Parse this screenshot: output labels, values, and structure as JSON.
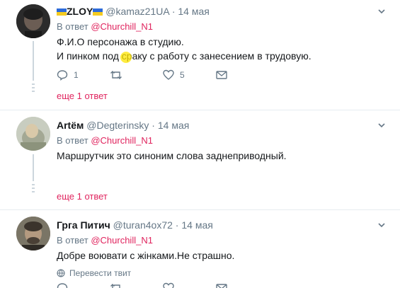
{
  "colors": {
    "accent": "#e0245e",
    "muted": "#657786",
    "text": "#14171a",
    "divider": "#e6ecf0",
    "thread": "#ccd6dd"
  },
  "tweets": [
    {
      "name": "ZLOY",
      "name_flags": [
        "ukraine-flag-icon",
        "ukraine-flag-icon"
      ],
      "handle": "@kamaz21UA",
      "dot": "·",
      "time": "14 мая",
      "reply_prefix": "В ответ",
      "reply_to": "@Churchill_N1",
      "lines": [
        "Ф.И.О персонажа в студию.",
        "И пинком под сраку с работу с занесением в трудовую."
      ],
      "reply_count": "1",
      "retweet_count": "",
      "like_count": "5",
      "more_replies": "еще 1 ответ"
    },
    {
      "name": "Artём",
      "handle": "@Degterinsky",
      "dot": "·",
      "time": "14 мая",
      "reply_prefix": "В ответ",
      "reply_to": "@Churchill_N1",
      "lines": [
        "Маршрутчик это синоним слова заднеприводный."
      ],
      "more_replies": "еще 1 ответ"
    },
    {
      "name": "Грга Питич",
      "handle": "@turan4ox72",
      "dot": "·",
      "time": "14 мая",
      "reply_prefix": "В ответ",
      "reply_to": "@Churchill_N1",
      "lines": [
        "Добре воювати с жінками.Не страшно."
      ],
      "translate_label": "Перевести твит"
    }
  ]
}
